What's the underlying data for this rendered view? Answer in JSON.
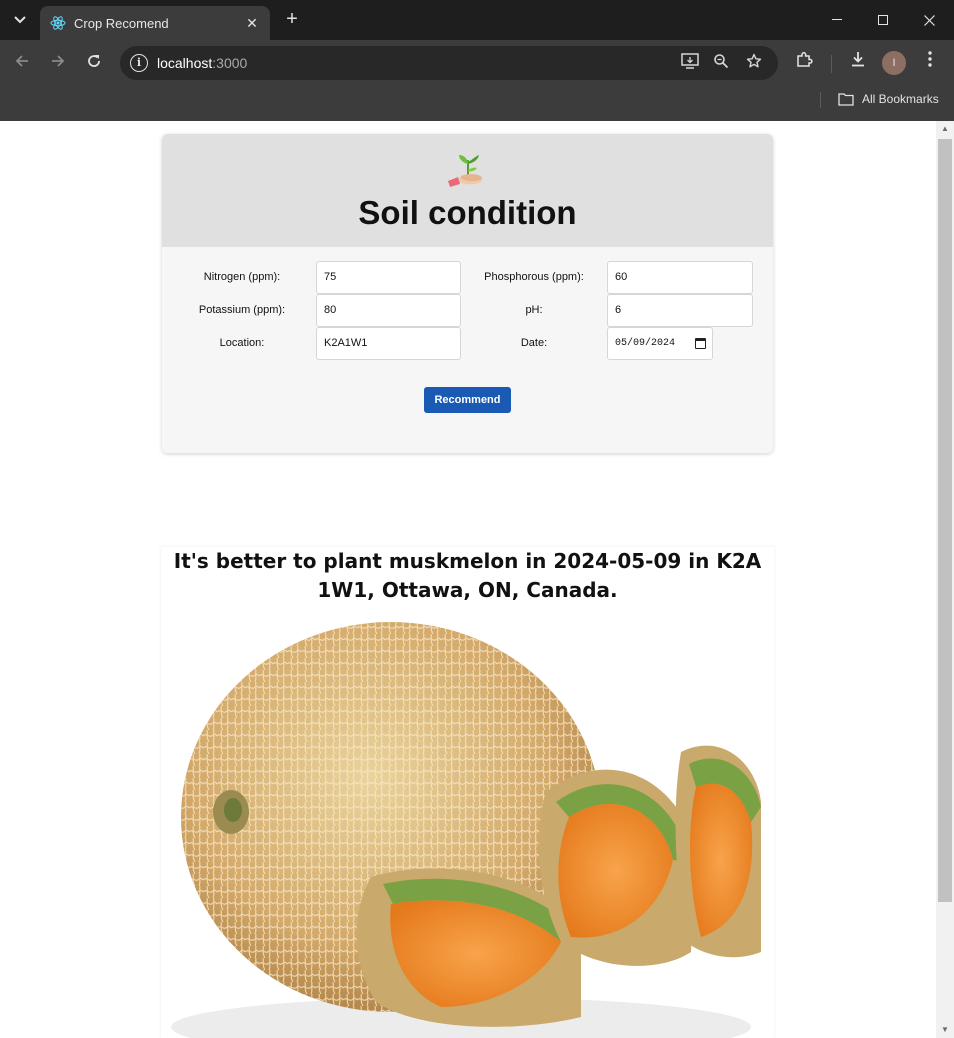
{
  "browser": {
    "tab_title": "Crop Recomend",
    "url_host": "localhost",
    "url_port": ":3000",
    "bookmarks_label": "All Bookmarks",
    "profile_initial": "I"
  },
  "form": {
    "title": "Soil condition",
    "nitrogen_label": "Nitrogen (ppm):",
    "nitrogen_value": "75",
    "phosphorous_label": "Phosphorous (ppm):",
    "phosphorous_value": "60",
    "potassium_label": "Potassium (ppm):",
    "potassium_value": "80",
    "ph_label": "pH:",
    "ph_value": "6",
    "location_label": "Location:",
    "location_value": "K2A1W1",
    "date_label": "Date:",
    "date_value": "05/09/2024",
    "submit_label": "Recommend"
  },
  "result": {
    "text": "It's better to plant muskmelon in 2024-05-09 in K2A 1W1, Ottawa, ON, Canada."
  },
  "colors": {
    "accent": "#1a5ab4",
    "header_bg": "#e0e0e0",
    "card_bg": "#f6f6f6"
  },
  "icons": {
    "tab_favicon": "react-atom-icon",
    "logo": "sprout-in-hand-icon"
  }
}
